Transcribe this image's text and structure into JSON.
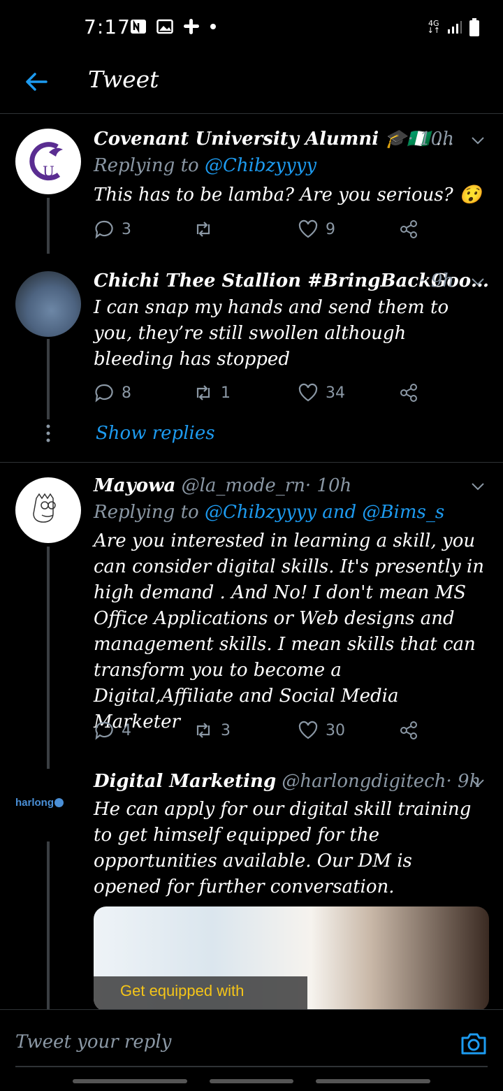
{
  "status": {
    "time": "7:17",
    "network": "4G"
  },
  "header": {
    "title": "Tweet"
  },
  "tweets": [
    {
      "name": "Covenant University Alumni",
      "name_suffix": "🎓🇳🇬 …",
      "time": "· 10h",
      "replying_label": "Replying to",
      "replying_to": "@Chibzyyyy",
      "text": "This has to be lamba? Are you serious? 😯",
      "replies": "3",
      "retweets": "",
      "likes": "9"
    },
    {
      "name": "Chichi Thee Stallion #BringBackGoo…",
      "time": "· 9h",
      "text": "I can snap my hands and send them to you, they’re still swollen although bleeding has stopped",
      "replies": "8",
      "retweets": "1",
      "likes": "34"
    },
    {
      "name": "Mayowa",
      "handle": "@la_mode_rn",
      "time": "· 10h",
      "replying_label": "Replying to",
      "replying_to": "@Chibzyyyy and @Bims_s",
      "text": "Are you interested in learning a skill, you can consider digital skills. It's presently in high demand . And No! I don't mean MS Office Applications or Web designs and management skills. I mean skills that can transform you to become a Digital,Affiliate and Social Media Marketer",
      "replies": "4",
      "retweets": "3",
      "likes": "30"
    },
    {
      "name": "Digital Marketing",
      "handle": "@harlongdigitech",
      "time": "· 9h",
      "text": "He can apply for our digital skill training to get himself equipped for the opportunities available. Our DM is opened for further conversation.",
      "logo": "harlong",
      "media_caption": "Get equipped with"
    }
  ],
  "show_replies": "Show replies",
  "reply_bar": {
    "placeholder": "Tweet your reply"
  },
  "colors": {
    "accent": "#1d9bf0",
    "muted": "#8b98a5",
    "background": "#000000"
  }
}
